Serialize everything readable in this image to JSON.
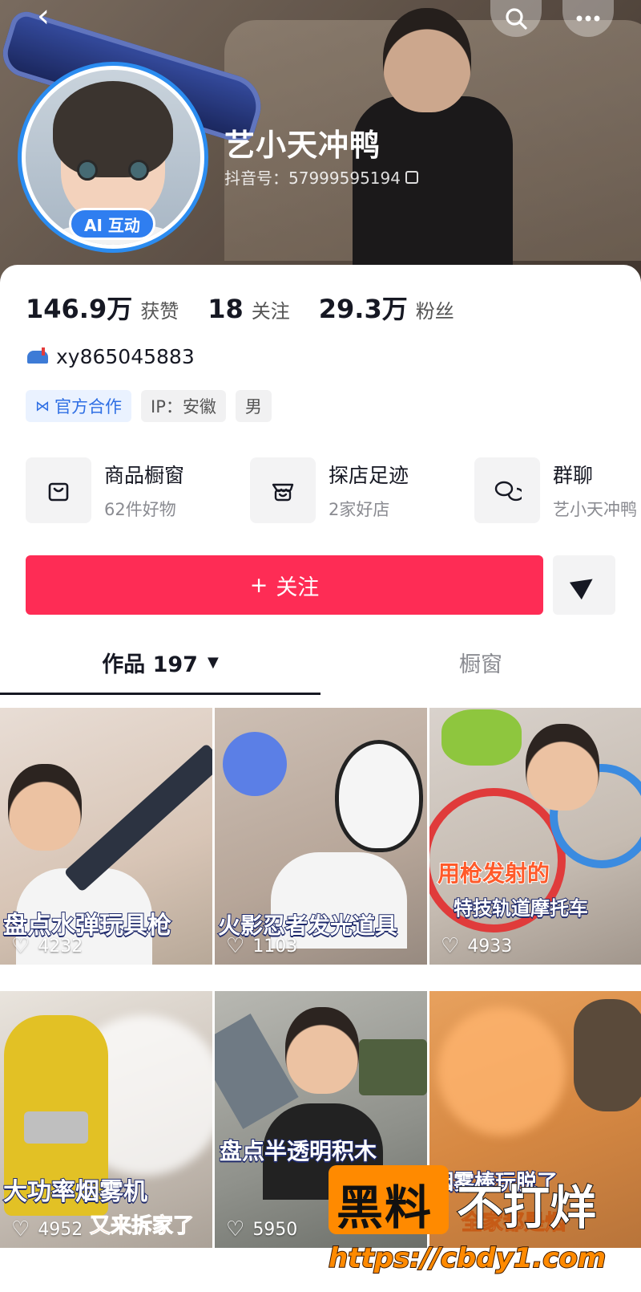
{
  "header": {
    "nickname": "艺小天冲鸭",
    "douyin_id": "抖音号：57999595194",
    "ai_badge": "AI 互动"
  },
  "stats": [
    {
      "value": "146.9万",
      "label": "获赞"
    },
    {
      "value": "18",
      "label": "关注"
    },
    {
      "value": "29.3万",
      "label": "粉丝"
    }
  ],
  "signature": "xy865045883",
  "tags": [
    {
      "label": "官方合作"
    },
    {
      "label": "IP：安徽"
    },
    {
      "label": "男"
    }
  ],
  "services": [
    {
      "title": "商品橱窗",
      "sub": "62件好物",
      "icon": "shopping-bag-icon"
    },
    {
      "title": "探店足迹",
      "sub": "2家好店",
      "icon": "store-icon"
    },
    {
      "title": "群聊",
      "sub": "艺小天冲鸭",
      "icon": "chat-bubbles-icon"
    }
  ],
  "actions": {
    "follow": "关注",
    "follow_prefix": "+"
  },
  "tabs": {
    "works_label": "作品 197",
    "showcase_label": "橱窗"
  },
  "videos": [
    {
      "caption": "盘点水弹玩具枪",
      "likes": "4232"
    },
    {
      "caption": "火影忍者发光道具",
      "likes": "1103"
    },
    {
      "caption": "特技轨道摩托车",
      "caption_top": "用枪发射的",
      "likes": "4933"
    },
    {
      "caption": "大功率烟雾机",
      "caption_sub": "又来拆家了",
      "likes": "4952"
    },
    {
      "caption": "盘点半透明积木",
      "likes": "5950"
    },
    {
      "caption": "烟雾棒玩脱了",
      "caption_sub": "全家都是烟",
      "likes": ""
    }
  ],
  "watermark": {
    "text_a": "黑料",
    "text_b": "不打烊",
    "url": "https://cbdy1.com"
  },
  "colors": {
    "accent": "#fe2c55",
    "avatar_ring": "#2b8cf0",
    "official_tag": "#2f6fe4"
  }
}
